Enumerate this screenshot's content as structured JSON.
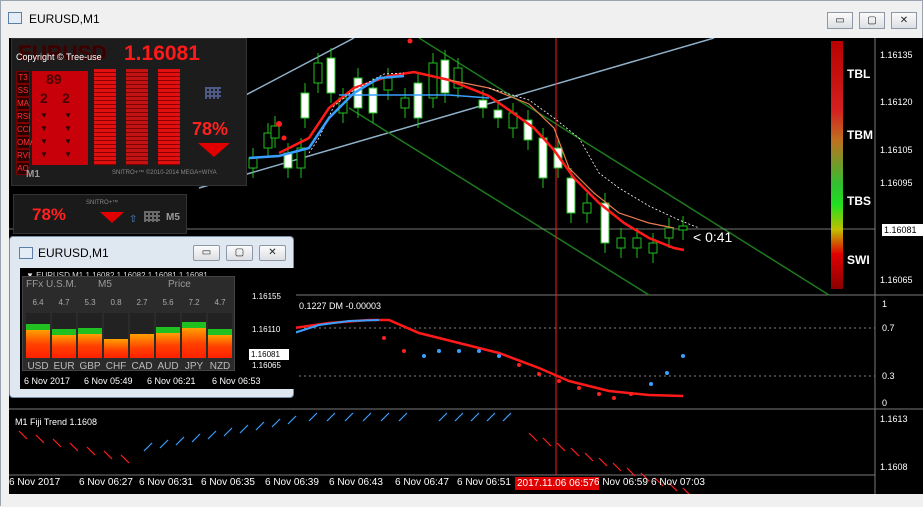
{
  "window": {
    "title": "EURUSD,M1",
    "min_glyph": "▭",
    "max_glyph": "▢",
    "close_glyph": "✕"
  },
  "main_chart": {
    "y_ticks": [
      "1.16135",
      "1.16120",
      "1.16105",
      "1.16095",
      "1.16081",
      "1.16065"
    ],
    "current_price": "1.16081",
    "countdown": "< 0:41",
    "gauge_labels": [
      "TBL",
      "TBM",
      "TBS",
      "SWI"
    ],
    "x_ticks": [
      "6 Nov 2017",
      "6 Nov 06:27",
      "6 Nov 06:31",
      "6 Nov 06:35",
      "6 Nov 06:39",
      "6 Nov 06:43",
      "6 Nov 06:47",
      "6 Nov 06:51",
      "6 Nov 06:59",
      "6 Nov 07:03"
    ],
    "x_highlight": "2017.11.06 06:57",
    "indicator1_label": "0.1227 DM -0.00003",
    "indicator1_ticks": [
      "1",
      "0.7",
      "0.3",
      "0"
    ],
    "indicator2_label": "M1 Fiji Trend 1.1608",
    "indicator2_ticks": [
      "1.1613",
      "1.1608"
    ]
  },
  "overlay_top": {
    "symbol": "EURUSD",
    "price": "1.16081",
    "copyright": "Copyright © Tree-use",
    "labels": [
      "T3",
      "SS",
      "MA",
      "RSI",
      "CCI",
      "OMA",
      "RVI",
      "AO"
    ],
    "num1": "89",
    "num2a": "2",
    "num2b": "2",
    "arrow_glyph": "▼",
    "percent": "78%",
    "timeframe": "M1",
    "brand": "SNITRO+™ ©2010-2014 MEGA+WIYA"
  },
  "overlay_small": {
    "percent": "78%",
    "brand": "SNITRO+™",
    "up_glyph": "⇧",
    "timeframe": "M5"
  },
  "subwindow": {
    "title": "EURUSD,M1",
    "header": "▼ EURUSD,M1  1.16082 1.16082 1.16081 1.16081",
    "usm_title": "FFx U.S.M.",
    "usm_tf": "M5",
    "usm_price": "Price",
    "values": [
      "6.4",
      "4.7",
      "5.3",
      "0.8",
      "2.7",
      "5.6",
      "7.2",
      "4.7"
    ],
    "currencies": [
      "USD",
      "EUR",
      "GBP",
      "CHF",
      "CAD",
      "AUD",
      "JPY",
      "NZD"
    ],
    "strength": [
      0.62,
      0.45,
      0.5,
      0.1,
      0.28,
      0.52,
      0.7,
      0.45
    ],
    "y_ticks": [
      "1.16155",
      "1.16110",
      "1.16065"
    ],
    "price_tag": "1.16081",
    "x_ticks": [
      "6 Nov 2017",
      "6 Nov 05:49",
      "6 Nov 06:21",
      "6 Nov 06:53"
    ]
  }
}
